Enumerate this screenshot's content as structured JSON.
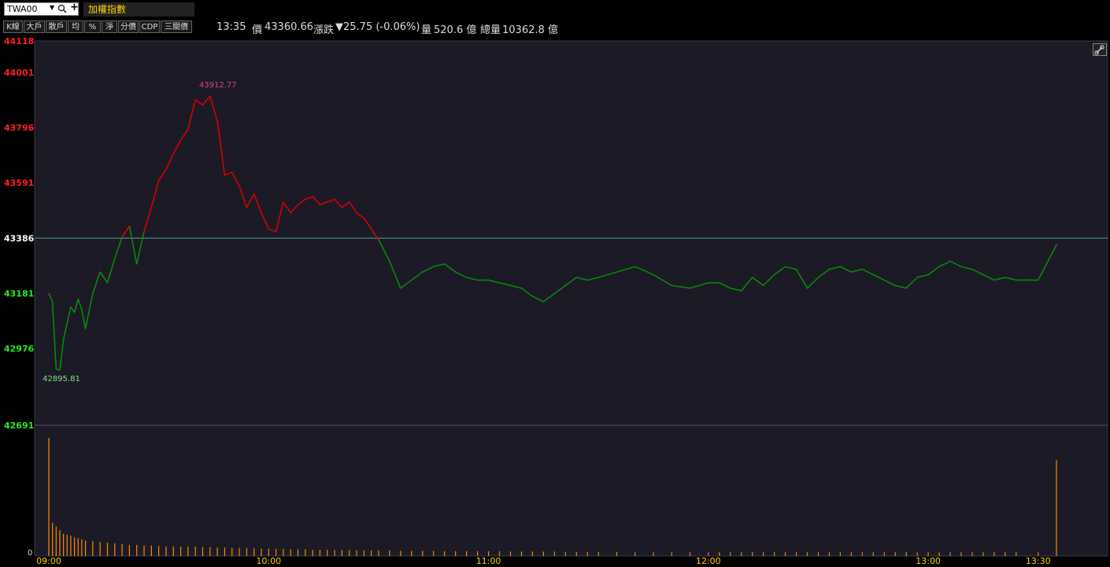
{
  "header": {
    "symbol": "TWA00",
    "name": "加權指數"
  },
  "toolbar": {
    "buttons": [
      "K線",
      "大戶",
      "散戶",
      "均",
      "%",
      "淨",
      "分價",
      "CDP",
      "三關價"
    ]
  },
  "quote": {
    "time": "13:35",
    "price_label": "價",
    "price": "43360.66",
    "change_label": "漲跌",
    "change": "▼25.75 (-0.06%)",
    "volume_label": "量",
    "volume": "520.6 億",
    "total_volume_label": "總量",
    "total_volume": "10362.8 億"
  },
  "colors": {
    "up": "#e00000",
    "down": "#0a8f0a",
    "up_label": "#ff2020",
    "down_label": "#22ee22",
    "volume": "#ff8c00",
    "background": "#1c1a26",
    "grid": "#3a3a4a"
  },
  "chart_data": {
    "type": "line",
    "reference_price": 43386,
    "ylim": [
      42691,
      44118
    ],
    "y_ticks": [
      "44118",
      "44001",
      "43796",
      "43591",
      "43386",
      "43181",
      "42976",
      "42691"
    ],
    "x_ticks": [
      "09:00",
      "10:00",
      "11:00",
      "12:00",
      "13:00",
      "13:30"
    ],
    "high_label": "43912.77",
    "low_label": "42895.81",
    "volume_zero_label": "0",
    "x": [
      "09:00",
      "09:01",
      "09:02",
      "09:03",
      "09:04",
      "09:05",
      "09:06",
      "09:07",
      "09:08",
      "09:09",
      "09:10",
      "09:12",
      "09:14",
      "09:16",
      "09:18",
      "09:20",
      "09:22",
      "09:24",
      "09:26",
      "09:28",
      "09:30",
      "09:32",
      "09:34",
      "09:36",
      "09:38",
      "09:40",
      "09:42",
      "09:44",
      "09:46",
      "09:48",
      "09:50",
      "09:52",
      "09:54",
      "09:56",
      "09:58",
      "10:00",
      "10:02",
      "10:04",
      "10:06",
      "10:08",
      "10:10",
      "10:12",
      "10:14",
      "10:16",
      "10:18",
      "10:20",
      "10:22",
      "10:24",
      "10:26",
      "10:28",
      "10:30",
      "10:33",
      "10:36",
      "10:39",
      "10:42",
      "10:45",
      "10:48",
      "10:51",
      "10:54",
      "10:57",
      "11:00",
      "11:03",
      "11:06",
      "11:09",
      "11:12",
      "11:15",
      "11:18",
      "11:21",
      "11:24",
      "11:27",
      "11:30",
      "11:35",
      "11:40",
      "11:45",
      "11:50",
      "11:55",
      "12:00",
      "12:03",
      "12:06",
      "12:09",
      "12:12",
      "12:15",
      "12:18",
      "12:21",
      "12:24",
      "12:27",
      "12:30",
      "12:33",
      "12:36",
      "12:39",
      "12:42",
      "12:45",
      "12:48",
      "12:51",
      "12:54",
      "12:57",
      "13:00",
      "13:03",
      "13:06",
      "13:09",
      "13:12",
      "13:15",
      "13:18",
      "13:21",
      "13:24",
      "13:30",
      "13:35"
    ],
    "price": [
      43180,
      43150,
      42900,
      42896,
      43010,
      43070,
      43130,
      43110,
      43160,
      43120,
      43050,
      43180,
      43260,
      43220,
      43310,
      43390,
      43430,
      43290,
      43410,
      43500,
      43600,
      43640,
      43700,
      43750,
      43790,
      43900,
      43880,
      43913,
      43820,
      43620,
      43630,
      43580,
      43500,
      43550,
      43480,
      43420,
      43410,
      43520,
      43480,
      43510,
      43530,
      43540,
      43510,
      43520,
      43530,
      43500,
      43520,
      43480,
      43460,
      43420,
      43380,
      43300,
      43200,
      43230,
      43260,
      43280,
      43290,
      43260,
      43240,
      43230,
      43230,
      43220,
      43210,
      43200,
      43170,
      43150,
      43180,
      43210,
      43240,
      43230,
      43240,
      43260,
      43280,
      43250,
      43210,
      43200,
      43220,
      43220,
      43200,
      43190,
      43240,
      43210,
      43250,
      43280,
      43270,
      43200,
      43240,
      43270,
      43280,
      43260,
      43270,
      43250,
      43230,
      43210,
      43200,
      43240,
      43250,
      43280,
      43300,
      43280,
      43270,
      43250,
      43230,
      43240,
      43230,
      43230,
      43361
    ],
    "volume": [
      320,
      90,
      80,
      70,
      60,
      58,
      55,
      50,
      48,
      45,
      42,
      40,
      38,
      36,
      34,
      32,
      30,
      30,
      28,
      28,
      27,
      26,
      26,
      25,
      25,
      25,
      24,
      24,
      23,
      23,
      22,
      22,
      21,
      21,
      20,
      20,
      19,
      19,
      18,
      18,
      18,
      17,
      17,
      17,
      16,
      16,
      16,
      15,
      15,
      15,
      15,
      15,
      14,
      14,
      14,
      14,
      13,
      13,
      13,
      13,
      13,
      13,
      12,
      12,
      12,
      12,
      12,
      11,
      11,
      11,
      11,
      11,
      10,
      10,
      10,
      10,
      10,
      10,
      10,
      10,
      10,
      10,
      10,
      10,
      10,
      10,
      10,
      10,
      10,
      10,
      10,
      10,
      10,
      10,
      10,
      10,
      10,
      10,
      10,
      10,
      10,
      10,
      10,
      10,
      10,
      10,
      260
    ]
  }
}
